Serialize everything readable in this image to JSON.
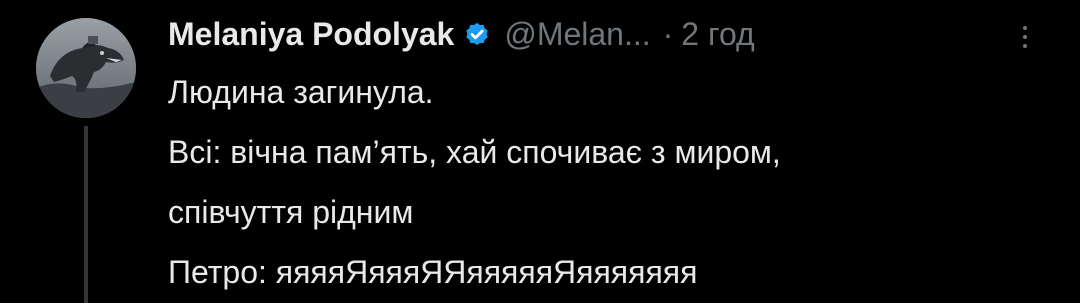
{
  "tweet": {
    "author": {
      "name": "Melaniya Podolyak",
      "handle": "@Melan...",
      "verified": true,
      "avatar_icon": "dinosaur-avatar-icon",
      "verified_icon": "verified-badge-icon",
      "verified_color": "#1d9bf0"
    },
    "separator": "·",
    "time": "2 год",
    "more_icon": "more-vertical-icon",
    "lines": [
      "Людина загинула.",
      "Всі: вічна пам’ять, хай спочиває з миром,",
      "співчуття рідним",
      "Петро: яяяяЯяяяЯЯяяяяяЯяяяяяяя"
    ]
  },
  "colors": {
    "background": "#000000",
    "text_primary": "#e7e9ea",
    "text_secondary": "#71767b",
    "thread_line": "#333639"
  }
}
